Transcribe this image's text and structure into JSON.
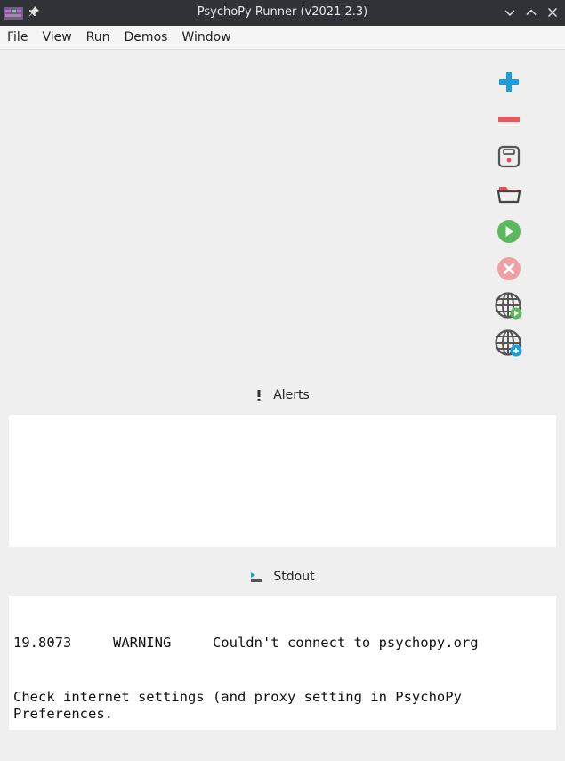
{
  "window": {
    "title": "PsychoPy Runner (v2021.2.3)"
  },
  "menu": {
    "items": [
      "File",
      "View",
      "Run",
      "Demos",
      "Window"
    ]
  },
  "toolbar": {
    "buttons": [
      {
        "name": "add-icon",
        "color": "#1a9ee0"
      },
      {
        "name": "remove-icon",
        "color": "#e8575f"
      },
      {
        "name": "save-icon",
        "color": "#555555"
      },
      {
        "name": "open-folder-icon",
        "color": "#e84d4d"
      },
      {
        "name": "run-icon",
        "color": "#5cb85c"
      },
      {
        "name": "stop-icon",
        "color": "#f0a0a3"
      },
      {
        "name": "run-online-icon",
        "color": "#5cb85c"
      },
      {
        "name": "sync-online-icon",
        "color": "#1a9ee0"
      }
    ]
  },
  "alerts": {
    "label": "Alerts"
  },
  "stdout": {
    "label": "Stdout",
    "line1": "19.8073     WARNING     Couldn't connect to psychopy.org",
    "line2": "Check internet settings (and proxy setting in PsychoPy Preferences."
  }
}
